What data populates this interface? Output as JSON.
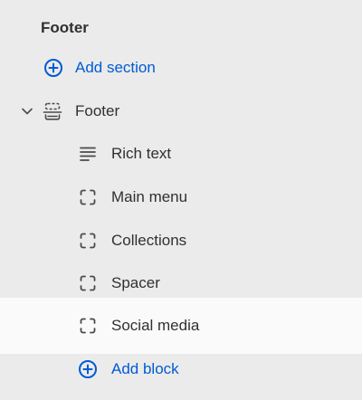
{
  "panel": {
    "title": "Footer",
    "add_section_label": "Add section",
    "section": {
      "label": "Footer",
      "blocks": [
        {
          "label": "Rich text",
          "icon": "text-lines-icon"
        },
        {
          "label": "Main menu",
          "icon": "block-icon"
        },
        {
          "label": "Collections",
          "icon": "block-icon"
        },
        {
          "label": "Spacer",
          "icon": "block-icon"
        },
        {
          "label": "Social media",
          "icon": "block-icon",
          "selected": true
        }
      ],
      "add_block_label": "Add block"
    }
  },
  "colors": {
    "background": "#ebebeb",
    "selected_row": "#fafafa",
    "link": "#005bd3",
    "text": "#303030"
  }
}
